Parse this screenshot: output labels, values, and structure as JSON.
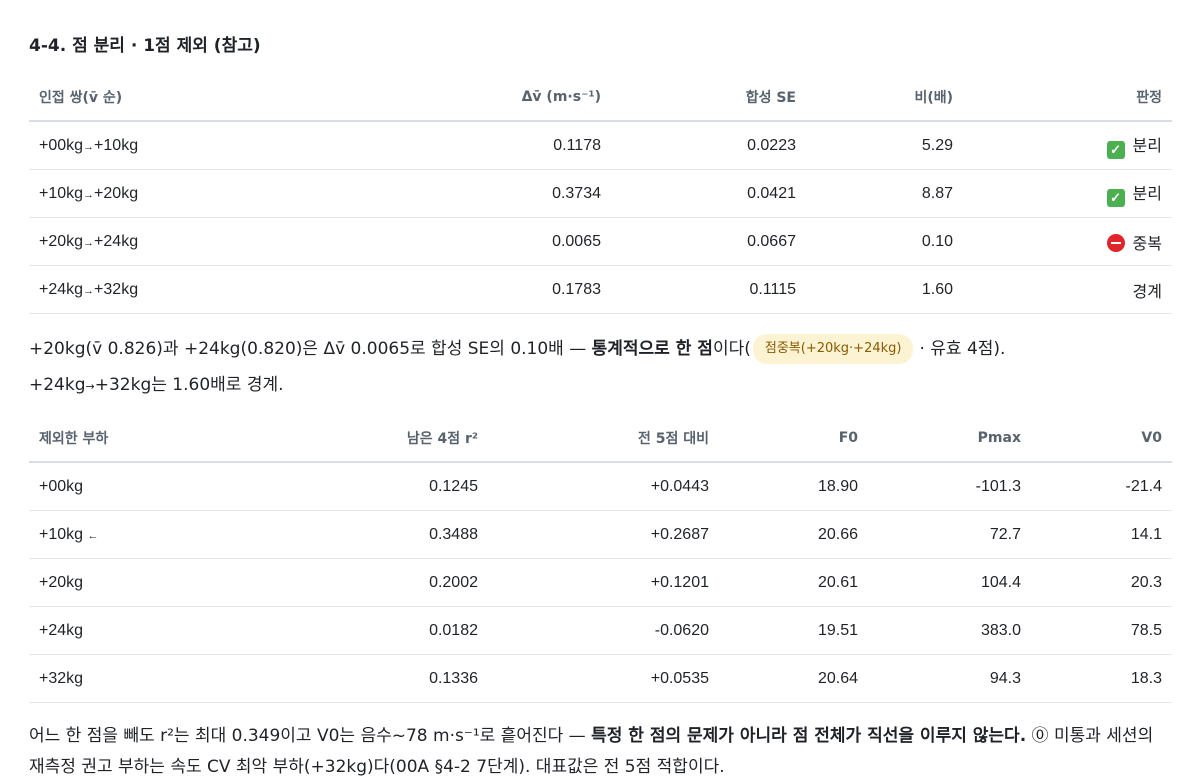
{
  "section_title": "4-4. 점 분리 · 1점 제외 (참고)",
  "separation_table": {
    "headers": [
      "인접 쌍(v̄ 순)",
      "Δv̄ (m·s⁻¹)",
      "합성 SE",
      "비(배)",
      "판정"
    ],
    "rows": [
      {
        "pair": "+00kg→+10kg",
        "from": "+00kg",
        "to": "+10kg",
        "dv": "0.1178",
        "se": "0.0223",
        "ratio": "5.29",
        "verdict": "분리",
        "icon": "check-icon"
      },
      {
        "pair": "+10kg→+20kg",
        "from": "+10kg",
        "to": "+20kg",
        "dv": "0.3734",
        "se": "0.0421",
        "ratio": "8.87",
        "verdict": "분리",
        "icon": "check-icon"
      },
      {
        "pair": "+20kg→+24kg",
        "from": "+20kg",
        "to": "+24kg",
        "dv": "0.0065",
        "se": "0.0667",
        "ratio": "0.10",
        "verdict": "중복",
        "icon": "stop-icon"
      },
      {
        "pair": "+24kg→+32kg",
        "from": "+24kg",
        "to": "+32kg",
        "dv": "0.1783",
        "se": "0.1115",
        "ratio": "1.60",
        "verdict": "경계",
        "icon": ""
      }
    ]
  },
  "paragraph1": {
    "line1_a": "+20kg(v̄ 0.826)과 +24kg(0.820)은 Δv̄ 0.0065로 합성 SE의 0.10배 — ",
    "line1_bold": "통계적으로 한 점",
    "line1_b": "이다(",
    "badge": "점중복(+20kg·+24kg)",
    "line1_c": "· 유효 4점).",
    "line2_a": "+24kg",
    "line2_arrow": "→",
    "line2_b": "+32kg는 1.60배로 경계."
  },
  "exclusion_table": {
    "headers": [
      "제외한 부하",
      "남은 4점 r²",
      "전 5점 대비",
      "F0",
      "Pmax",
      "V0"
    ],
    "rows": [
      {
        "load": "+00kg",
        "marker": "",
        "r2": "0.1245",
        "delta": "+0.0443",
        "f0": "18.90",
        "pmax": "-101.3",
        "v0": "-21.4"
      },
      {
        "load": "+10kg",
        "marker": "←",
        "r2": "0.3488",
        "delta": "+0.2687",
        "f0": "20.66",
        "pmax": "72.7",
        "v0": "14.1"
      },
      {
        "load": "+20kg",
        "marker": "",
        "r2": "0.2002",
        "delta": "+0.1201",
        "f0": "20.61",
        "pmax": "104.4",
        "v0": "20.3"
      },
      {
        "load": "+24kg",
        "marker": "",
        "r2": "0.0182",
        "delta": "-0.0620",
        "f0": "19.51",
        "pmax": "383.0",
        "v0": "78.5"
      },
      {
        "load": "+32kg",
        "marker": "",
        "r2": "0.1336",
        "delta": "+0.0535",
        "f0": "20.64",
        "pmax": "94.3",
        "v0": "18.3"
      }
    ]
  },
  "paragraph2": {
    "a": "어느 한 점을 빼도 r²는 최대 0.349이고 V0는 음수~78 m·s⁻¹로 흩어진다 — ",
    "bold": "특정 한 점의 문제가 아니라 점 전체가 직선을 이루지 않는다.",
    "b": " ⓪ 미통과 세션의 재측정 권고 부하는 속도 CV 최악 부하(+32kg)다(00A §4-2 7단계). 대표값은 전 5점 적합이다."
  },
  "colors": {
    "badge_bg": "#fbf3d2",
    "badge_text": "#8a5a00",
    "check": "#4caf50",
    "stop": "#e0262b"
  }
}
